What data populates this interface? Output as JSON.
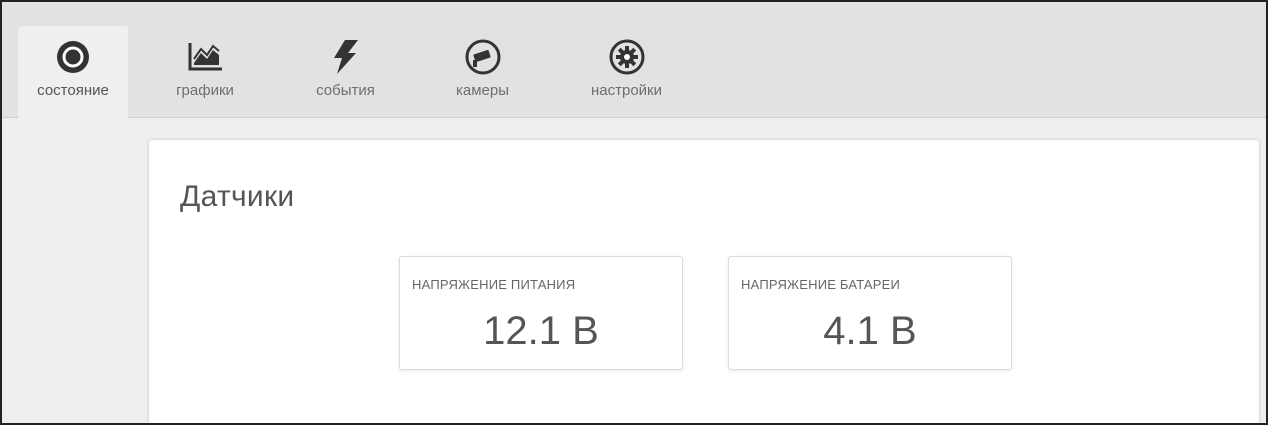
{
  "nav": {
    "tabs": [
      {
        "label": "состояние",
        "icon": "status-circle-icon",
        "active": true
      },
      {
        "label": "графики",
        "icon": "chart-icon",
        "active": false
      },
      {
        "label": "события",
        "icon": "lightning-icon",
        "active": false
      },
      {
        "label": "камеры",
        "icon": "camera-icon",
        "active": false
      },
      {
        "label": "настройки",
        "icon": "gear-icon",
        "active": false
      }
    ]
  },
  "main": {
    "title": "Датчики",
    "sensors": [
      {
        "label": "НАПРЯЖЕНИЕ ПИТАНИЯ",
        "value": "12.1 В"
      },
      {
        "label": "НАПРЯЖЕНИЕ БАТАРЕИ",
        "value": "4.1 В"
      }
    ]
  },
  "colors": {
    "nav_bg": "#e2e2e2",
    "page_bg": "#efefef",
    "icon": "#333333",
    "text": "#555555"
  }
}
